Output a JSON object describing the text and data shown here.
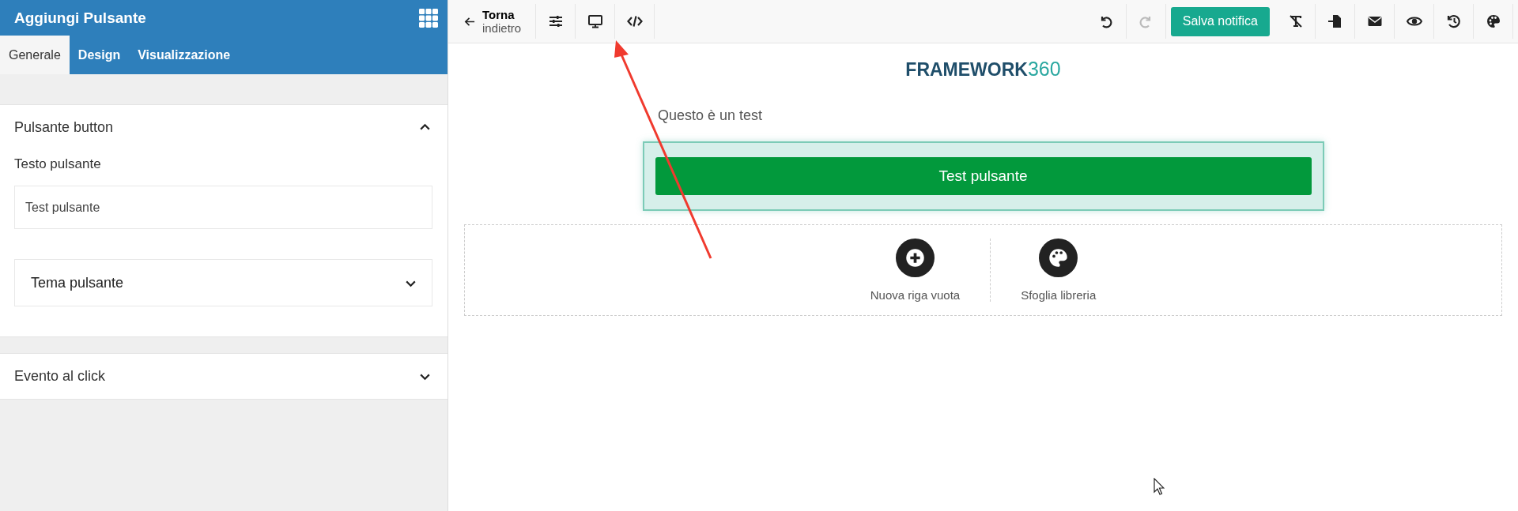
{
  "sidebar": {
    "title": "Aggiungi Pulsante",
    "tabs": [
      {
        "label": "Generale",
        "selected": true
      },
      {
        "label": "Design",
        "selected": false
      },
      {
        "label": "Visualizzazione",
        "selected": false
      }
    ],
    "sections": [
      {
        "title": "Pulsante button",
        "expanded": true,
        "fields": [
          {
            "kind": "text",
            "label": "Testo pulsante",
            "value": "Test pulsante"
          },
          {
            "kind": "dropdown",
            "label": "Tema pulsante",
            "expanded": false
          }
        ]
      },
      {
        "title": "Evento al click",
        "expanded": false
      }
    ]
  },
  "toolbar": {
    "back": {
      "line_1": "Torna",
      "line_2": "indietro"
    },
    "undo": {
      "disabled": false
    },
    "redo": {
      "disabled": true
    },
    "save_button": "Salva notifica"
  },
  "canvas": {
    "logo": {
      "word": "FRAMEWORK",
      "number": "360"
    },
    "text": "Questo è un test",
    "button": {
      "label": "Test pulsante",
      "selected": true
    },
    "add_row_actions": [
      {
        "kind": "new-row",
        "label": "Nuova riga vuota"
      },
      {
        "kind": "library",
        "label": "Sfoglia libreria"
      }
    ]
  },
  "annotation_arrow": true,
  "mouse_cursor": true
}
